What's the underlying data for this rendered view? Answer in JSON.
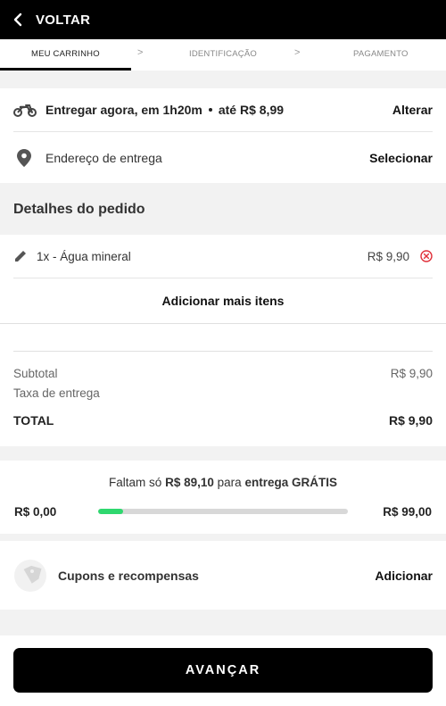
{
  "header": {
    "back_label": "VOLTAR"
  },
  "steps": {
    "items": [
      "MEU CARRINHO",
      "IDENTIFICAÇÃO",
      "PAGAMENTO"
    ],
    "separator": ">"
  },
  "delivery": {
    "time_text": "Entregar agora, em 1h20m",
    "fee_text": "até R$ 8,99",
    "change_label": "Alterar",
    "address_label": "Endereço de entrega",
    "select_label": "Selecionar"
  },
  "order": {
    "title": "Detalhes do pedido",
    "items": [
      {
        "name": "1x - Água mineral",
        "price": "R$ 9,90"
      }
    ],
    "add_more_label": "Adicionar mais itens"
  },
  "summary": {
    "subtotal_label": "Subtotal",
    "subtotal_value": "R$ 9,90",
    "delivery_fee_label": "Taxa de entrega",
    "total_label": "TOTAL",
    "total_value": "R$ 9,90"
  },
  "free_delivery": {
    "prefix": "Faltam só",
    "amount": "R$ 89,10",
    "middle": "para",
    "suffix": "entrega GRÁTIS",
    "min_label": "R$ 0,00",
    "max_label": "R$ 99,00",
    "progress_fraction": 0.1
  },
  "coupons": {
    "label": "Cupons e recompensas",
    "action_label": "Adicionar"
  },
  "footer": {
    "advance_label": "AVANÇAR"
  },
  "colors": {
    "accent_green": "#2fd86f",
    "remove_red": "#e0303a",
    "primary_black": "#000000"
  },
  "icons": {
    "back": "chevron-left-icon",
    "motorcycle": "motorcycle-icon",
    "location": "location-pin-icon",
    "edit": "pencil-icon",
    "remove": "close-circle-icon",
    "coupon": "coupon-tag-icon"
  }
}
